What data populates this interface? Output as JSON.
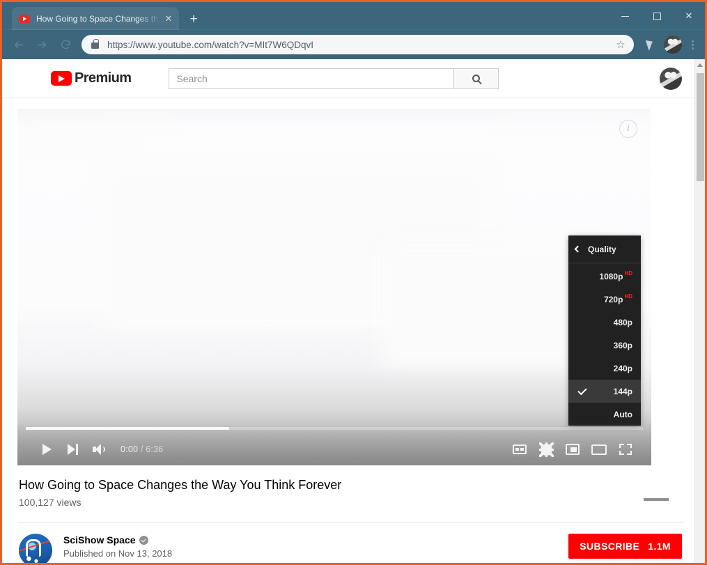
{
  "browser": {
    "tab": {
      "title": "How Going to Space Changes th",
      "favicon_icon": "youtube-favicon",
      "close_icon": "close-icon"
    },
    "new_tab_label": "+",
    "window_controls": {
      "minimize": "minimize-icon",
      "maximize": "maximize-icon",
      "close": "close-icon"
    },
    "toolbar": {
      "back_icon": "back-arrow-icon",
      "forward_icon": "forward-arrow-icon",
      "reload_icon": "reload-icon",
      "lock_icon": "lock-icon",
      "url": "https://www.youtube.com/watch?v=MIt7W6QDqvI",
      "bookmark_icon": "star-icon",
      "extension_icon": "extension-icon",
      "profile_icon": "profile-avatar-icon",
      "menu_icon": "kebab-menu-icon"
    }
  },
  "youtube": {
    "header": {
      "logo_text": "Premium",
      "logo_icon": "youtube-play-logo",
      "search_placeholder": "Search",
      "search_value": "",
      "search_icon": "search-icon",
      "avatar_icon": "account-avatar"
    },
    "player": {
      "info_icon": "info-icon",
      "current_time": "0:00",
      "duration": "6:36",
      "time_separator": "/",
      "progress_percent": 0,
      "buffered_percent": 33,
      "controls": {
        "play_icon": "play-icon",
        "next_icon": "next-video-icon",
        "volume_icon": "volume-icon",
        "captions_icon": "closed-captions-icon",
        "settings_icon": "settings-gear-icon",
        "miniplayer_icon": "miniplayer-icon",
        "theater_icon": "theater-mode-icon",
        "fullscreen_icon": "fullscreen-icon"
      },
      "quality_menu": {
        "back_icon": "chevron-left-icon",
        "title": "Quality",
        "items": [
          {
            "label": "1080p",
            "badge": "HD",
            "selected": false
          },
          {
            "label": "720p",
            "badge": "HD",
            "selected": false
          },
          {
            "label": "480p",
            "badge": "",
            "selected": false
          },
          {
            "label": "360p",
            "badge": "",
            "selected": false
          },
          {
            "label": "240p",
            "badge": "",
            "selected": false
          },
          {
            "label": "144p",
            "badge": "",
            "selected": true
          },
          {
            "label": "Auto",
            "badge": "",
            "selected": false
          }
        ]
      }
    },
    "video": {
      "title": "How Going to Space Changes the Way You Think Forever",
      "views": "100,127 views"
    },
    "channel": {
      "avatar_icon": "scishow-space-avatar",
      "name": "SciShow Space",
      "verified_icon": "verified-badge-icon",
      "published": "Published on Nov 13, 2018",
      "subscribe_label": "SUBSCRIBE",
      "subscriber_count": "1.1M"
    }
  },
  "colors": {
    "youtube_red": "#ff0000",
    "titlebar": "#3b667b",
    "capture_border": "#e8622a",
    "menu_bg": "#212121",
    "menu_selected": "#3a3a3a"
  }
}
